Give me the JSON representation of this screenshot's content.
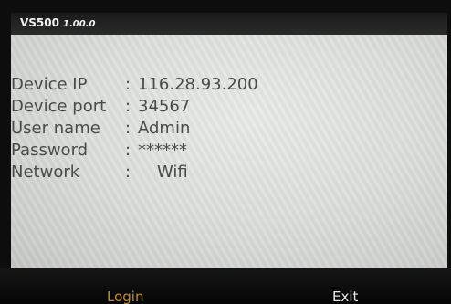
{
  "window": {
    "title": "VS500",
    "version": "1.00.0"
  },
  "info": {
    "rows": [
      {
        "label": "Device IP",
        "colon": ":",
        "value": "116.28.93.200"
      },
      {
        "label": "Device port",
        "colon": ":",
        "value": "34567"
      },
      {
        "label": "User name",
        "colon": ":",
        "value": "Admin"
      },
      {
        "label": "Password",
        "colon": ":",
        "value": "******"
      },
      {
        "label": "Network",
        "colon": ":",
        "value": "Wifi"
      }
    ]
  },
  "buttons": {
    "login": "Login",
    "exit": "Exit"
  },
  "colors": {
    "login_accent": "#c89018",
    "text": "#4a4a4a",
    "bezel": "#0d0d0d"
  }
}
